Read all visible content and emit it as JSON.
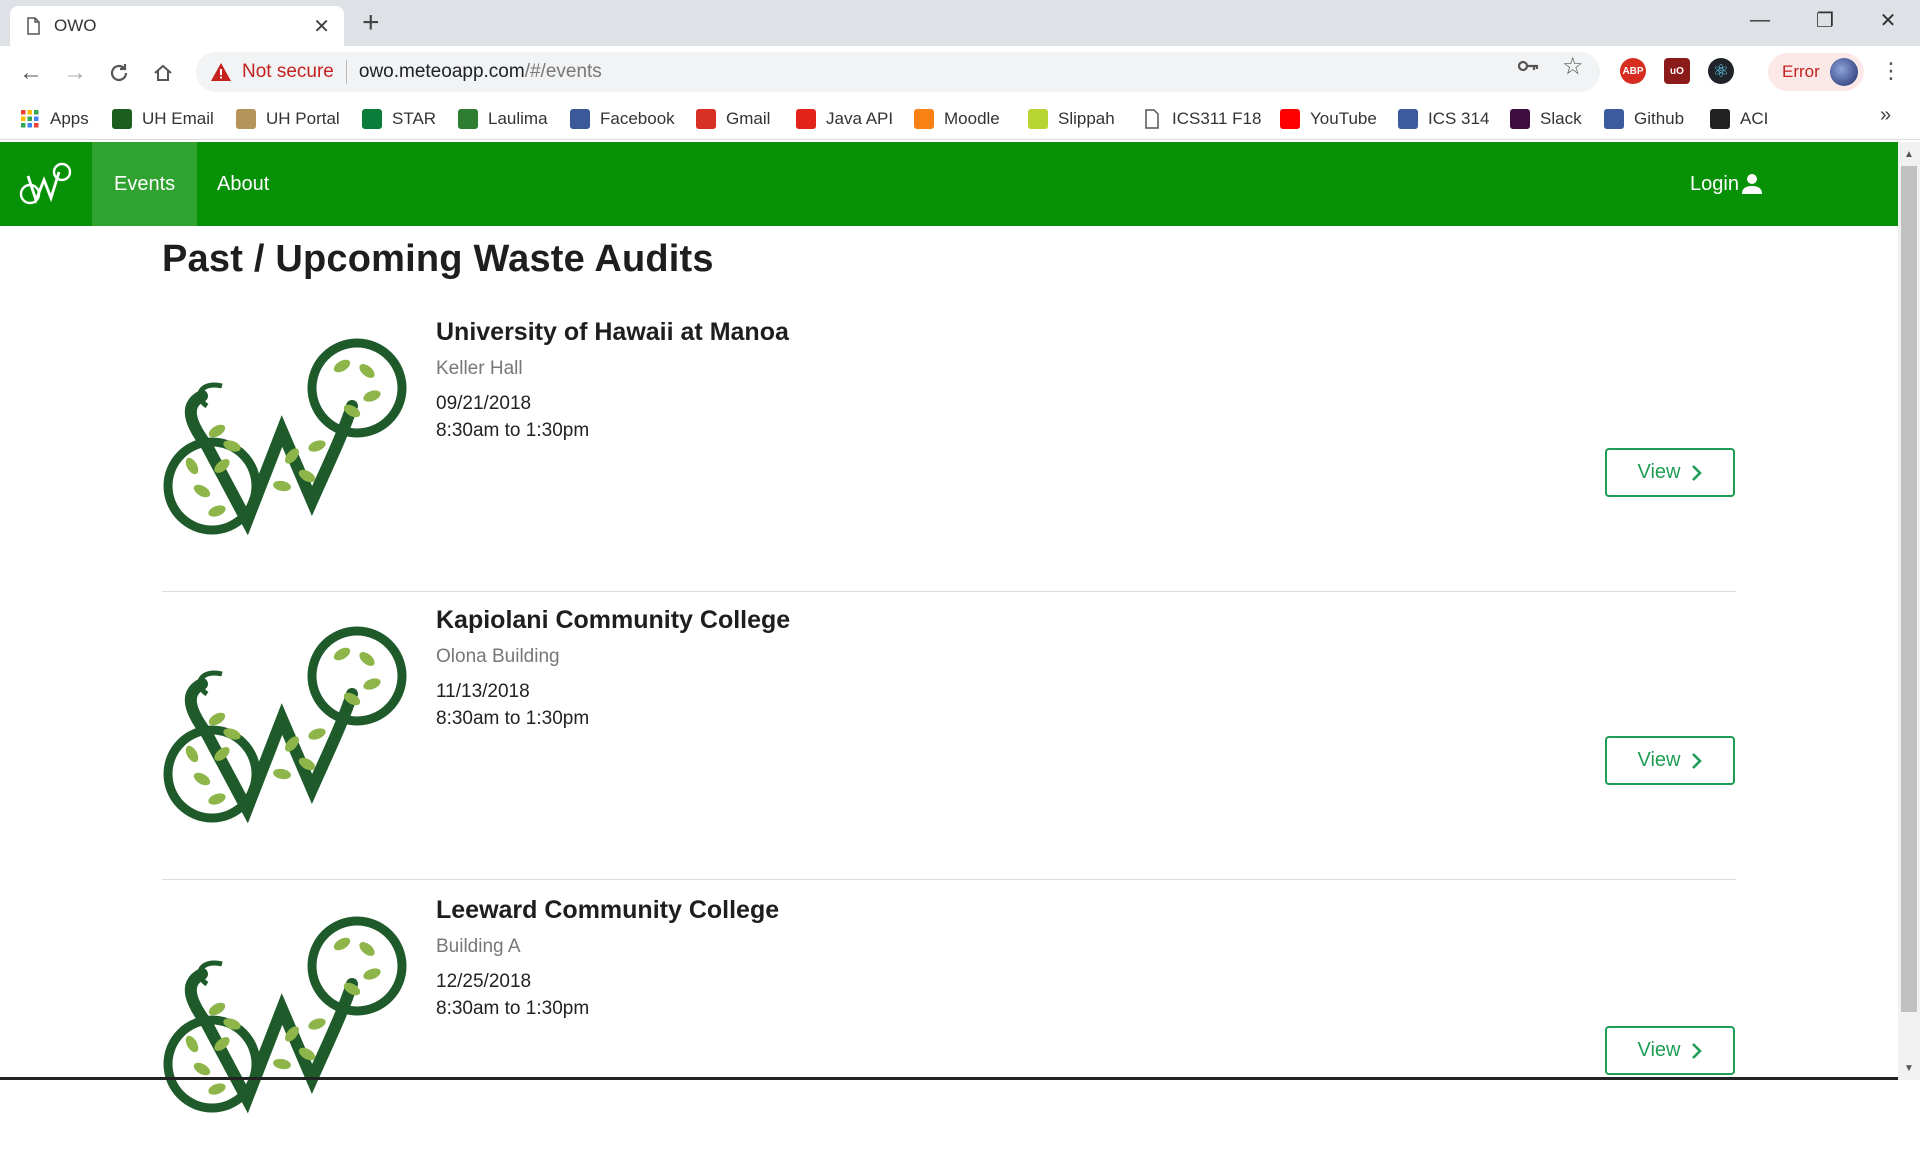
{
  "browser": {
    "tab_title": "OWO",
    "tab_close": "✕",
    "new_tab": "+",
    "not_secure": "Not secure",
    "url_host": "owo.meteoapp.com",
    "url_path": "/#/events",
    "error_label": "Error",
    "more_bookmarks": "»"
  },
  "bookmarks": [
    {
      "label": "Apps",
      "icon": "apps-grid-icon",
      "color": "#ea4335"
    },
    {
      "label": "UH Email",
      "icon": "uh-icon",
      "color": "#1b5e20"
    },
    {
      "label": "UH Portal",
      "icon": "uh-portal-icon",
      "color": "#b5945b"
    },
    {
      "label": "STAR",
      "icon": "star-diamond-icon",
      "color": "#0a7d3b"
    },
    {
      "label": "Laulima",
      "icon": "leaf-icon",
      "color": "#2e7d32"
    },
    {
      "label": "Facebook",
      "icon": "facebook-icon",
      "color": "#3b5998"
    },
    {
      "label": "Gmail",
      "icon": "gmail-icon",
      "color": "#d93025"
    },
    {
      "label": "Java API",
      "icon": "java-icon",
      "color": "#e2231a"
    },
    {
      "label": "Moodle",
      "icon": "moodle-icon",
      "color": "#f98012"
    },
    {
      "label": "Slippah",
      "icon": "slippah-icon",
      "color": "#b8d432"
    },
    {
      "label": "ICS311 F18",
      "icon": "page-icon",
      "color": "#777777"
    },
    {
      "label": "YouTube",
      "icon": "youtube-icon",
      "color": "#ff0000"
    },
    {
      "label": "ICS 314",
      "icon": "square-icon",
      "color": "#3b5b9e"
    },
    {
      "label": "Slack",
      "icon": "slack-icon",
      "color": "#3f0e40"
    },
    {
      "label": "Github",
      "icon": "square-icon",
      "color": "#3b5b9e"
    },
    {
      "label": "ACI",
      "icon": "github-icon",
      "color": "#222222"
    }
  ],
  "nav": {
    "items": [
      {
        "label": "Events",
        "active": true
      },
      {
        "label": "About",
        "active": false
      }
    ],
    "login": "Login",
    "color": "#069106"
  },
  "page": {
    "title": "Past / Upcoming Waste Audits",
    "view_label": "View",
    "events": [
      {
        "college": "University of Hawaii at Manoa",
        "building": "Keller Hall",
        "date": "09/21/2018",
        "time": "8:30am to 1:30pm"
      },
      {
        "college": "Kapiolani Community College",
        "building": "Olona Building",
        "date": "11/13/2018",
        "time": "8:30am to 1:30pm"
      },
      {
        "college": "Leeward Community College",
        "building": "Building A",
        "date": "12/25/2018",
        "time": "8:30am to 1:30pm"
      }
    ]
  },
  "colors": {
    "accent_green": "#1f9d55",
    "logo_dark_green": "#1e5a2a",
    "logo_leaf": "#8db54a"
  }
}
